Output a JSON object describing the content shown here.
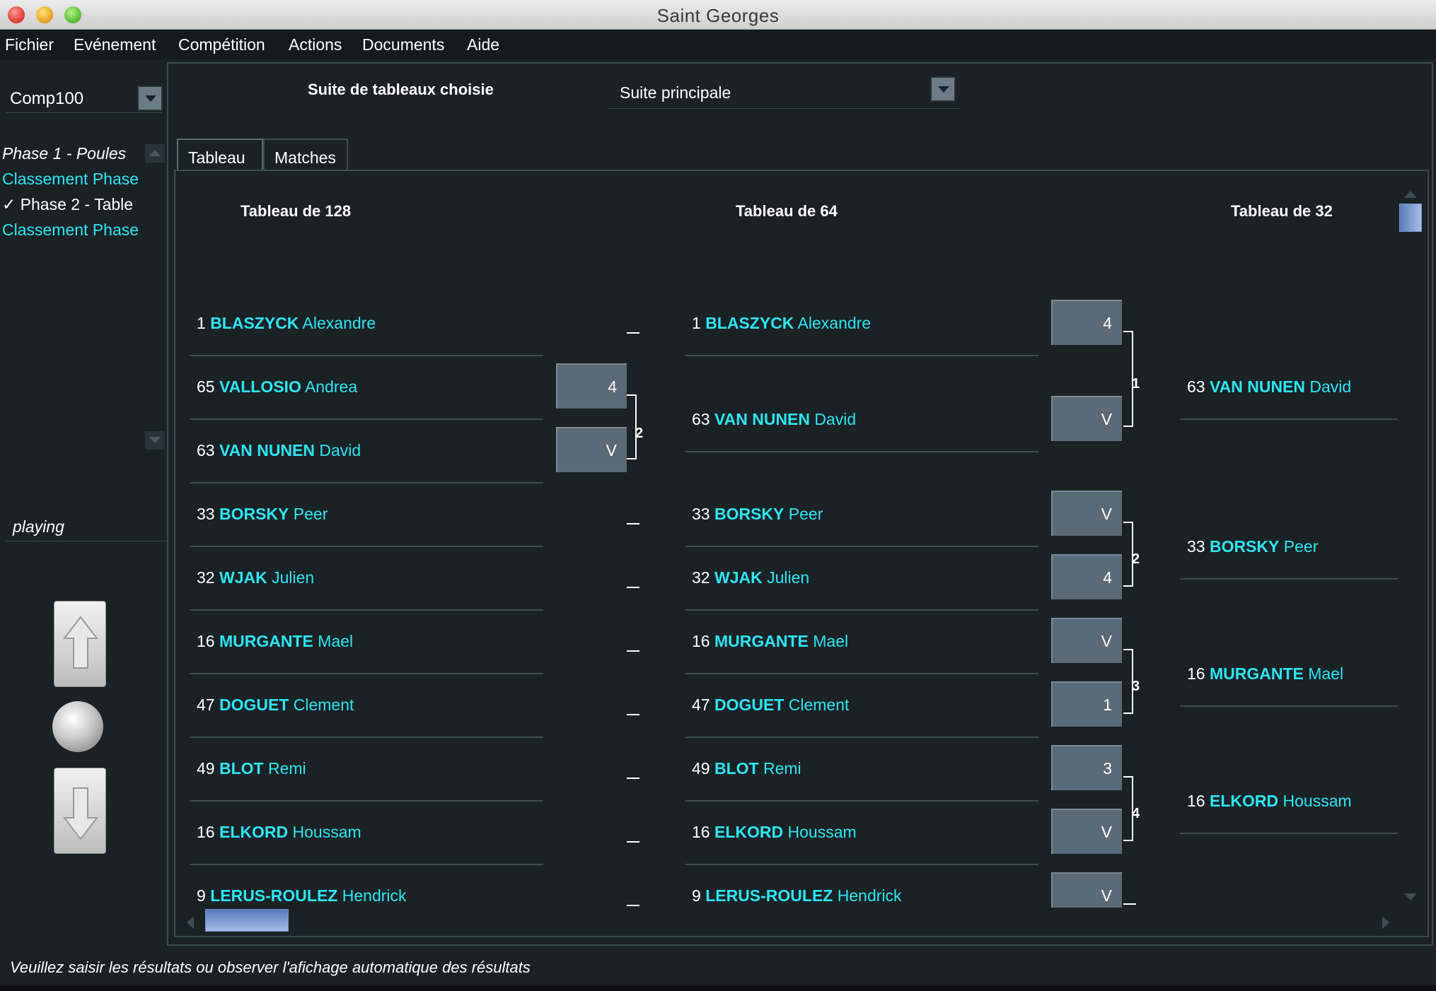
{
  "window": {
    "title": "Saint Georges"
  },
  "menu": [
    "Fichier",
    "Evénement",
    "Compétition",
    "Actions",
    "Documents",
    "Aide"
  ],
  "sidebar": {
    "competition": "Comp100",
    "phases": [
      {
        "label": "Phase 1 - Poules",
        "style": "white"
      },
      {
        "label": "Classement Phase",
        "style": "cyan"
      },
      {
        "label": "Phase 2 - Table",
        "style": "checked",
        "check": "✓"
      },
      {
        "label": "Classement Phase",
        "style": "cyan"
      }
    ],
    "status": "playing"
  },
  "suite": {
    "label": "Suite de tableaux choisie",
    "selected": "Suite principale"
  },
  "tabs": [
    "Tableau",
    "Matches"
  ],
  "rounds": [
    "Tableau de 128",
    "Tableau de 64",
    "Tableau de 32"
  ],
  "col128": [
    {
      "seed": "1",
      "last": "BLASZYCK",
      "first": "Alexandre"
    },
    {
      "seed": "65",
      "last": "VALLOSIO",
      "first": "Andrea"
    },
    {
      "seed": "63",
      "last": "VAN NUNEN",
      "first": "David"
    },
    {
      "seed": "33",
      "last": "BORSKY",
      "first": "Peer"
    },
    {
      "seed": "32",
      "last": "WJAK",
      "first": "Julien"
    },
    {
      "seed": "16",
      "last": "MURGANTE",
      "first": "Mael"
    },
    {
      "seed": "47",
      "last": "DOGUET",
      "first": "Clement"
    },
    {
      "seed": "49",
      "last": "BLOT",
      "first": "Remi"
    },
    {
      "seed": "16",
      "last": "ELKORD",
      "first": "Houssam"
    },
    {
      "seed": "9",
      "last": "LERUS-ROULEZ",
      "first": "Hendrick"
    }
  ],
  "col128_scores": [
    "4",
    "V"
  ],
  "col128_match": "2",
  "col64": [
    {
      "seed": "1",
      "last": "BLASZYCK",
      "first": "Alexandre"
    },
    {
      "seed": "63",
      "last": "VAN NUNEN",
      "first": "David"
    },
    {
      "seed": "33",
      "last": "BORSKY",
      "first": "Peer"
    },
    {
      "seed": "32",
      "last": "WJAK",
      "first": "Julien"
    },
    {
      "seed": "16",
      "last": "MURGANTE",
      "first": "Mael"
    },
    {
      "seed": "47",
      "last": "DOGUET",
      "first": "Clement"
    },
    {
      "seed": "49",
      "last": "BLOT",
      "first": "Remi"
    },
    {
      "seed": "16",
      "last": "ELKORD",
      "first": "Houssam"
    },
    {
      "seed": "9",
      "last": "LERUS-ROULEZ",
      "first": "Hendrick"
    }
  ],
  "col64_scores": [
    "4",
    "V",
    "V",
    "4",
    "V",
    "1",
    "3",
    "V",
    "V"
  ],
  "col64_matches": [
    "1",
    "2",
    "3",
    "4"
  ],
  "col32": [
    {
      "seed": "63",
      "last": "VAN NUNEN",
      "first": "David"
    },
    {
      "seed": "33",
      "last": "BORSKY",
      "first": "Peer"
    },
    {
      "seed": "16",
      "last": "MURGANTE",
      "first": "Mael"
    },
    {
      "seed": "16",
      "last": "ELKORD",
      "first": "Houssam"
    }
  ],
  "footer": "Veuillez saisir les résultats ou observer l'afichage automatique des résultats",
  "colors": {
    "accent_name": "#2ee5f0",
    "background": "#1a2226",
    "score_box": "#5a6a76"
  }
}
